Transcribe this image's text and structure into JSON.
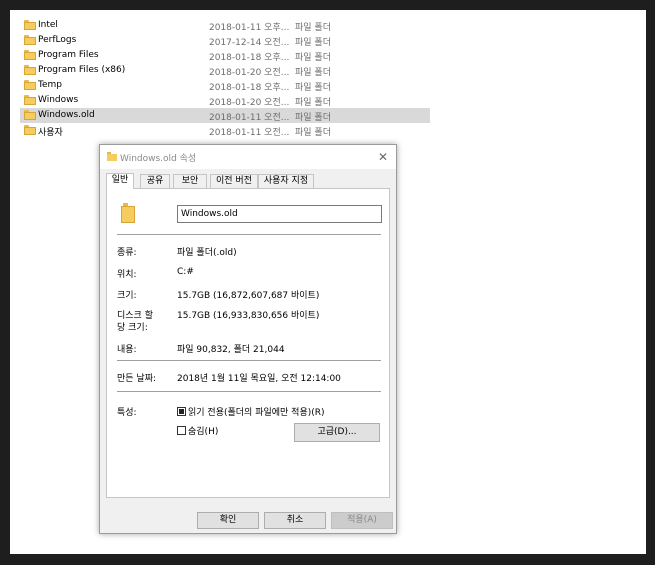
{
  "files": [
    {
      "name": "Intel",
      "date": "2018-01-11 오후...",
      "type": "파일 폴더"
    },
    {
      "name": "PerfLogs",
      "date": "2017-12-14 오전...",
      "type": "파일 폴더"
    },
    {
      "name": "Program Files",
      "date": "2018-01-18 오후...",
      "type": "파일 폴더"
    },
    {
      "name": "Program Files (x86)",
      "date": "2018-01-20 오전...",
      "type": "파일 폴더"
    },
    {
      "name": "Temp",
      "date": "2018-01-18 오후...",
      "type": "파일 폴더"
    },
    {
      "name": "Windows",
      "date": "2018-01-20 오전...",
      "type": "파일 폴더"
    },
    {
      "name": "Windows.old",
      "date": "2018-01-11 오전...",
      "type": "파일 폴더"
    },
    {
      "name": "사용자",
      "date": "2018-01-11 오전...",
      "type": "파일 폴더"
    }
  ],
  "dialog": {
    "title": "Windows.old 속성",
    "close_glyph": "✕",
    "tabs": [
      "일반",
      "공유",
      "보안",
      "이전 버전",
      "사용자 지정"
    ],
    "folder_name_value": "Windows.old",
    "type_label": "종류:",
    "type_value": "파일 폴더(.old)",
    "location_label": "위치:",
    "location_value": "C:#",
    "size_label": "크기:",
    "size_value": "15.7GB (16,872,607,687 바이트)",
    "disk_size_label_1": "디스크 할",
    "disk_size_label_2": "당 크기:",
    "disk_size_value": "15.7GB (16,933,830,656 바이트)",
    "contents_label": "내용:",
    "contents_value": "파일 90,832, 폴더 21,044",
    "created_label": "만든 날짜:",
    "created_value": "2018년 1월 11일 목요일, 오전 12:14:00",
    "attributes_label": "특성:",
    "readonly_label": "읽기 전용(폴더의 파일에만 적용)(R)",
    "hidden_label": "숨김(H)",
    "advanced_button": "고급(D)...",
    "ok_button": "확인",
    "cancel_button": "취소",
    "apply_button": "적용(A)"
  }
}
